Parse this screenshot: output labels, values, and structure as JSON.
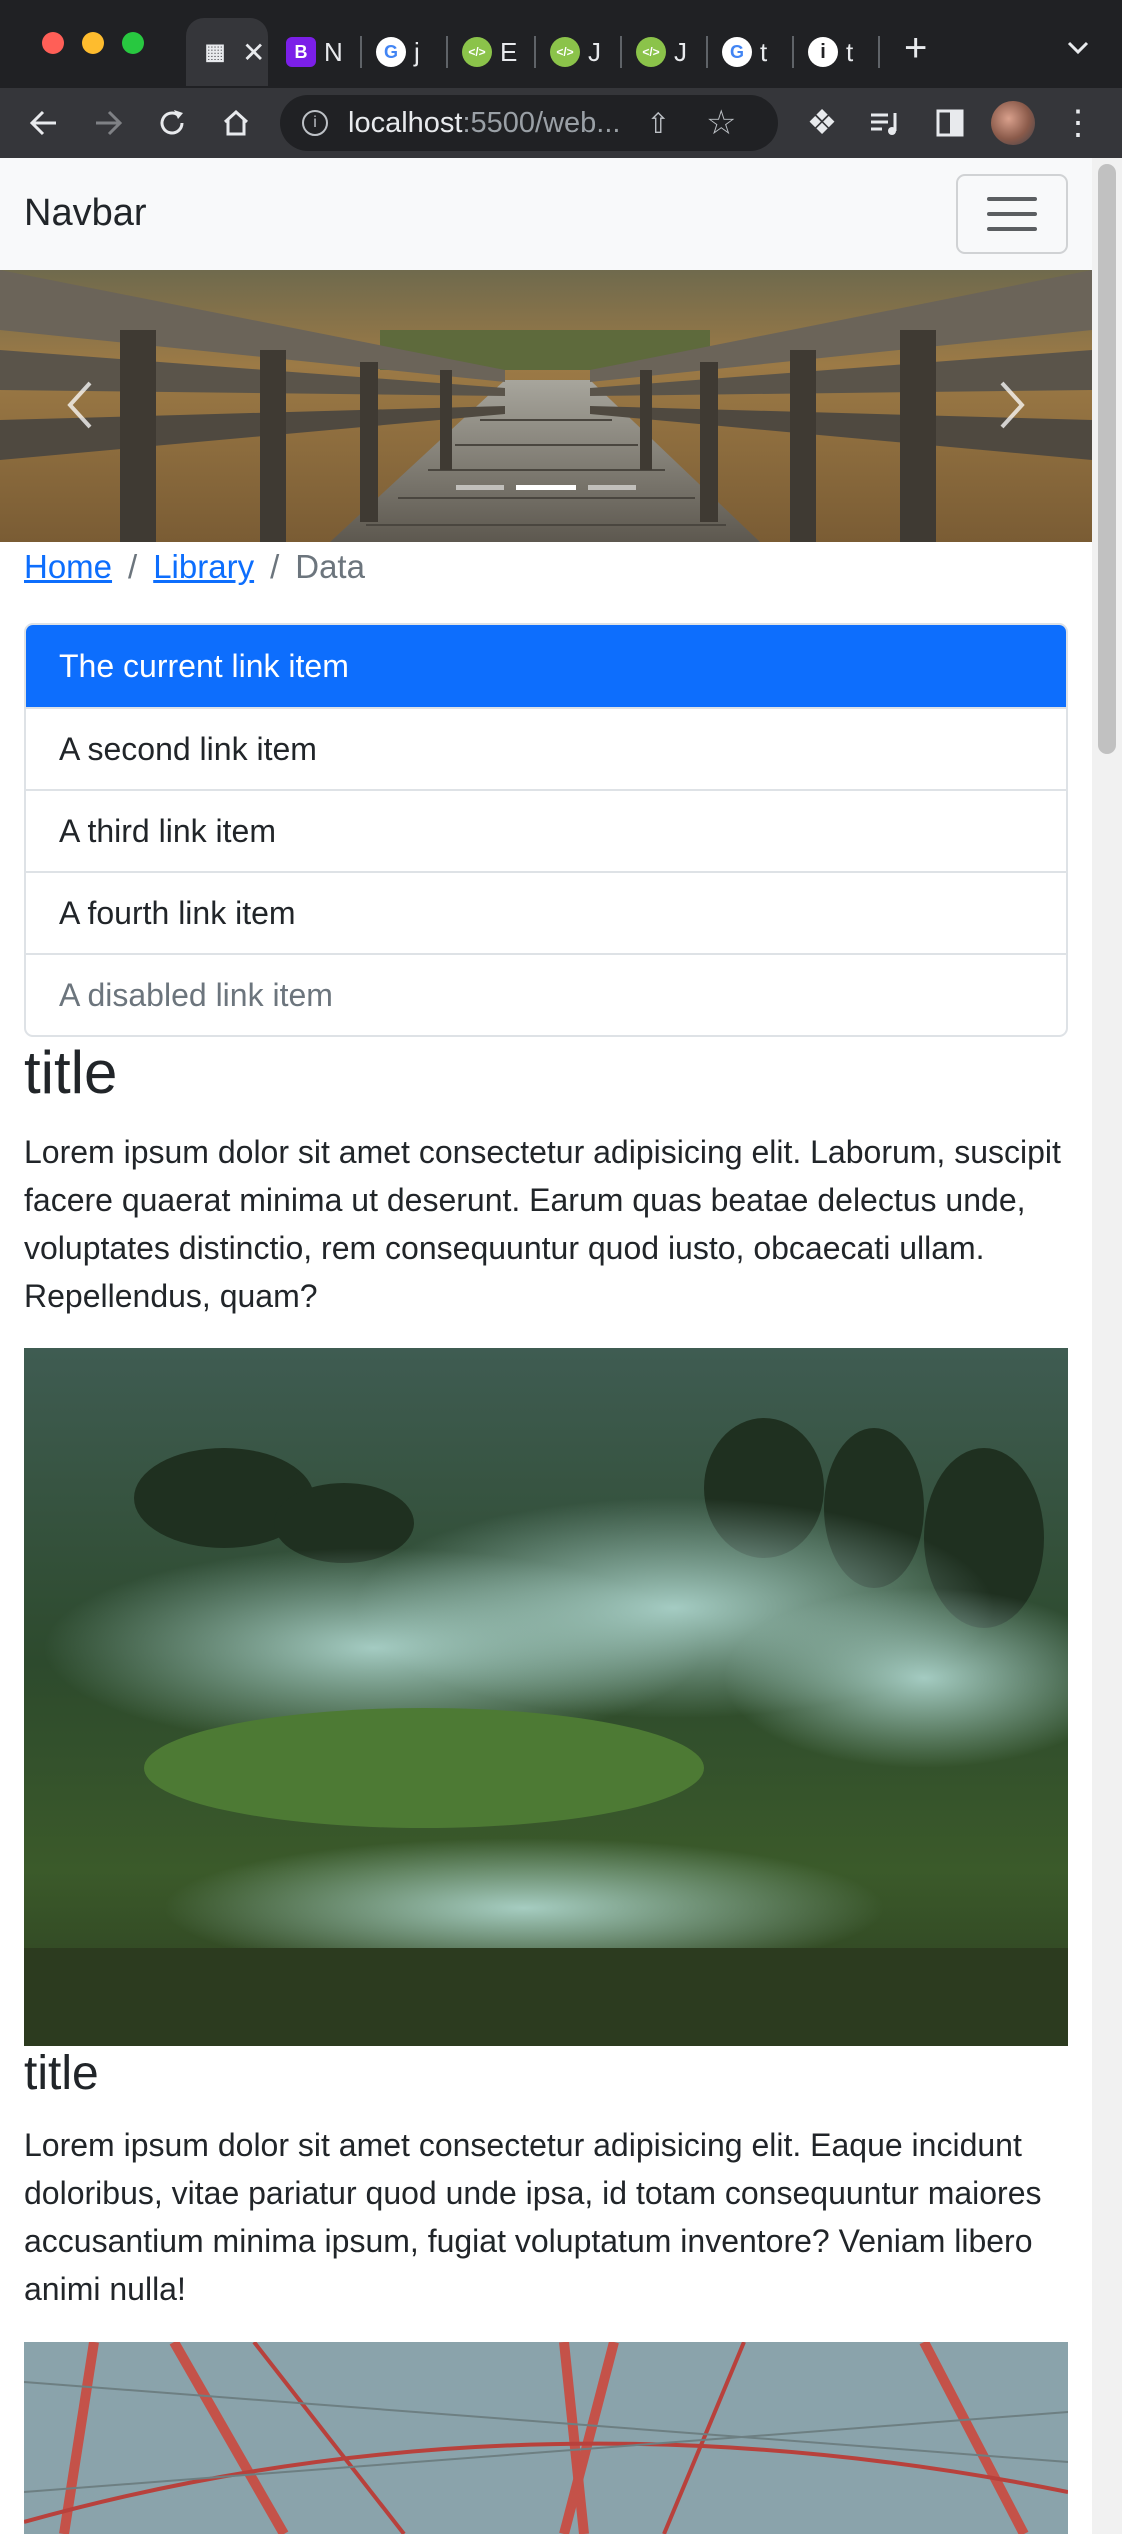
{
  "browser": {
    "tabs": [
      {
        "label": "",
        "favicon": "site-icon",
        "active": true
      },
      {
        "label": "N",
        "favicon": "bootstrap-icon"
      },
      {
        "label": "j",
        "favicon": "google-icon"
      },
      {
        "label": "E",
        "favicon": "code-icon"
      },
      {
        "label": "J",
        "favicon": "code-icon"
      },
      {
        "label": "J",
        "favicon": "code-icon"
      },
      {
        "label": "t",
        "favicon": "google-icon"
      },
      {
        "label": "t",
        "favicon": "info-icon"
      }
    ],
    "new_tab": "+",
    "url_host": "localhost",
    "url_rest": ":5500/web...",
    "colors": {
      "frame": "#202124",
      "toolbar": "#35363a",
      "bootstrap": "#7b1fe8"
    }
  },
  "page": {
    "navbar": {
      "brand": "Navbar"
    },
    "breadcrumb": {
      "home": "Home",
      "library": "Library",
      "current": "Data",
      "separator": "/"
    },
    "list_group": [
      {
        "label": "The current link item",
        "state": "active"
      },
      {
        "label": "A second link item",
        "state": "normal"
      },
      {
        "label": "A third link item",
        "state": "normal"
      },
      {
        "label": "A fourth link item",
        "state": "normal"
      },
      {
        "label": "A disabled link item",
        "state": "disabled"
      }
    ],
    "section1": {
      "title": "title",
      "body": "Lorem ipsum dolor sit amet consectetur adipisicing elit. Laborum, suscipit facere quaerat minima ut deserunt. Earum quas beatae delectus unde, voluptates distinctio, rem consequuntur quod iusto, obcaecati ullam. Repellendus, quam?"
    },
    "section2": {
      "title": "title",
      "body": "Lorem ipsum dolor sit amet consectetur adipisicing elit. Eaque incidunt doloribus, vitae pariatur quod unde ipsa, id totam consequuntur maiores accusantium minima ipsum, fugiat voluptatum inventore? Veniam libero animi nulla!"
    },
    "colors": {
      "primary": "#0d6efd",
      "navbar_bg": "#f8f9fa",
      "muted": "#6c757d"
    }
  }
}
